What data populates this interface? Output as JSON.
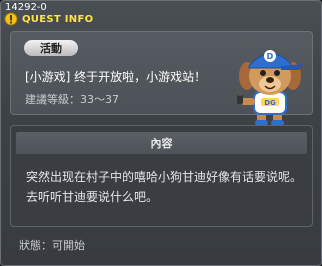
{
  "window": {
    "id_tag": "14292-0",
    "title": "QUEST INFO",
    "title_icon": "exclamation-icon"
  },
  "quest": {
    "badge": "活動",
    "name": "[小游戏] 终于开放啦，小游戏站！",
    "level_text": "建議等級：33～37",
    "mascot": "blue-cap-dog-mascot"
  },
  "content": {
    "header": "內容",
    "body": "突然出现在村子中的嘻哈小狗甘迪好像有话要说呢。去听听甘迪要说什么吧。"
  },
  "status": {
    "text": "狀態：可開始"
  },
  "colors": {
    "title": "#ffe24a",
    "badge_bg": "#e6e6e6",
    "panel": "#4f555a",
    "content_header": "#555b60"
  }
}
